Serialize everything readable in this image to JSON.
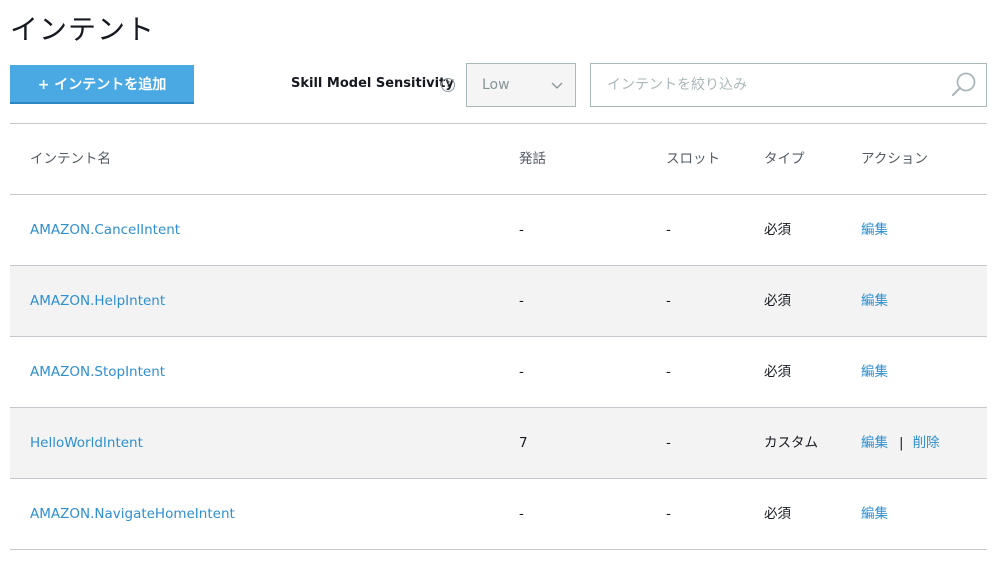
{
  "page": {
    "title": "インテント"
  },
  "toolbar": {
    "add_button_label": "+ インテントを追加",
    "sensitivity_label": "Skill Model Sensitivity",
    "help_glyph": "?",
    "sensitivity_value": "Low",
    "search_placeholder": "インテントを絞り込み",
    "search_value": ""
  },
  "table": {
    "columns": {
      "name": "インテント名",
      "utterances": "発話",
      "slots": "スロット",
      "type": "タイプ",
      "actions": "アクション"
    },
    "rows": [
      {
        "name": "AMAZON.CancelIntent",
        "utterances": "-",
        "slots": "-",
        "type": "必須",
        "edit": "編集",
        "delete": ""
      },
      {
        "name": "AMAZON.HelpIntent",
        "utterances": "-",
        "slots": "-",
        "type": "必須",
        "edit": "編集",
        "delete": ""
      },
      {
        "name": "AMAZON.StopIntent",
        "utterances": "-",
        "slots": "-",
        "type": "必須",
        "edit": "編集",
        "delete": ""
      },
      {
        "name": "HelloWorldIntent",
        "utterances": "7",
        "slots": "-",
        "type": "カスタム",
        "edit": "編集",
        "separator": "|",
        "delete": "削除"
      },
      {
        "name": "AMAZON.NavigateHomeIntent",
        "utterances": "-",
        "slots": "-",
        "type": "必須",
        "edit": "編集",
        "delete": ""
      }
    ]
  },
  "colors": {
    "accent": "#4aa8e3",
    "link": "#2e8fd0",
    "row_alt_bg": "#f3f3f3"
  },
  "icons": {
    "help": "question-circle-icon",
    "dropdown": "chevron-down-icon",
    "search": "search-icon"
  }
}
